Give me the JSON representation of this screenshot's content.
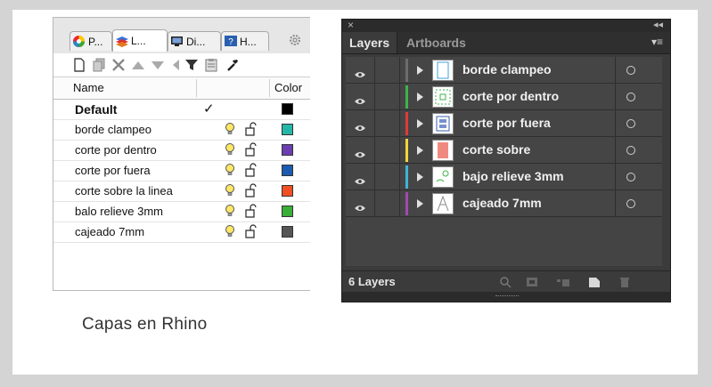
{
  "rhino": {
    "tabs": [
      {
        "label": "P...",
        "icon": "color-wheel-icon"
      },
      {
        "label": "L...",
        "icon": "layers-icon"
      },
      {
        "label": "Di...",
        "icon": "display-icon"
      },
      {
        "label": "H...",
        "icon": "help-icon"
      }
    ],
    "toolbar_icons": [
      "new-layer-icon",
      "new-sublayer-icon",
      "delete-icon",
      "move-up-icon",
      "move-down-icon",
      "move-left-icon",
      "filter-icon",
      "clipboard-icon",
      "tools-icon"
    ],
    "columns": {
      "name": "Name",
      "color": "Color"
    },
    "layers": [
      {
        "name": "Default",
        "bold": true,
        "current": true,
        "current_mark": "✓",
        "color": "#000000"
      },
      {
        "name": "borde clampeo",
        "color": "#25b6a8"
      },
      {
        "name": "corte por dentro",
        "color": "#6b3fb0"
      },
      {
        "name": "corte por fuera",
        "color": "#1c5bb0"
      },
      {
        "name": "corte sobre la linea",
        "color": "#f04e23"
      },
      {
        "name": "balo relieve 3mm",
        "color": "#3aae37"
      },
      {
        "name": "cajeado 7mm",
        "color": "#555555"
      }
    ]
  },
  "caption": "Capas en Rhino",
  "illustrator": {
    "close_glyph": "×",
    "collapse_glyph": "◂◂",
    "tabs": {
      "active": "Layers",
      "inactive": "Artboards"
    },
    "menu_glyph": "▾≡",
    "layers": [
      {
        "name": "borde clampeo",
        "color": "#6d6d6d"
      },
      {
        "name": "corte por dentro",
        "color": "#3fb34a"
      },
      {
        "name": "corte por fuera",
        "color": "#e03a3a"
      },
      {
        "name": "corte sobre",
        "color": "#f0d83a"
      },
      {
        "name": "bajo relieve 3mm",
        "color": "#3fb5d8"
      },
      {
        "name": "cajeado 7mm",
        "color": "#a04ab0"
      }
    ],
    "count_label": "6 Layers",
    "bottom_icons": [
      "locate-object-icon",
      "make-clipping-mask-icon",
      "create-sublayer-icon",
      "new-layer-icon",
      "trash-icon"
    ]
  }
}
